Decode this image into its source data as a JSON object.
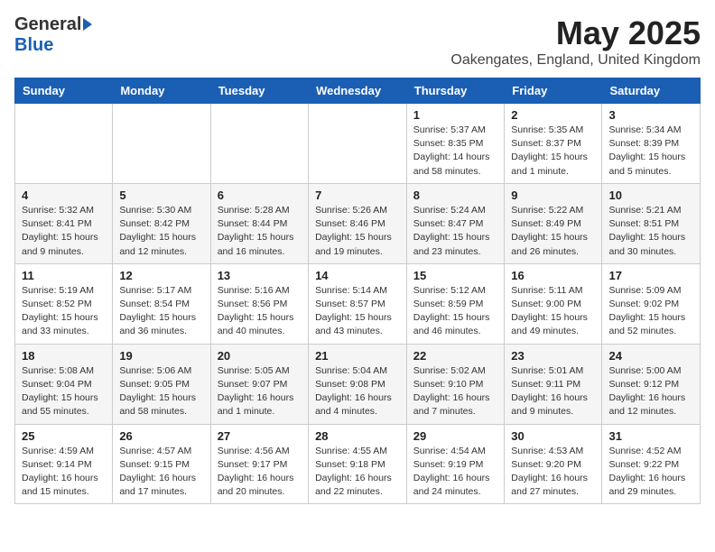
{
  "header": {
    "logo_general": "General",
    "logo_blue": "Blue",
    "month_title": "May 2025",
    "location": "Oakengates, England, United Kingdom"
  },
  "days_of_week": [
    "Sunday",
    "Monday",
    "Tuesday",
    "Wednesday",
    "Thursday",
    "Friday",
    "Saturday"
  ],
  "weeks": [
    [
      {
        "day": "",
        "info": ""
      },
      {
        "day": "",
        "info": ""
      },
      {
        "day": "",
        "info": ""
      },
      {
        "day": "",
        "info": ""
      },
      {
        "day": "1",
        "info": "Sunrise: 5:37 AM\nSunset: 8:35 PM\nDaylight: 14 hours\nand 58 minutes."
      },
      {
        "day": "2",
        "info": "Sunrise: 5:35 AM\nSunset: 8:37 PM\nDaylight: 15 hours\nand 1 minute."
      },
      {
        "day": "3",
        "info": "Sunrise: 5:34 AM\nSunset: 8:39 PM\nDaylight: 15 hours\nand 5 minutes."
      }
    ],
    [
      {
        "day": "4",
        "info": "Sunrise: 5:32 AM\nSunset: 8:41 PM\nDaylight: 15 hours\nand 9 minutes."
      },
      {
        "day": "5",
        "info": "Sunrise: 5:30 AM\nSunset: 8:42 PM\nDaylight: 15 hours\nand 12 minutes."
      },
      {
        "day": "6",
        "info": "Sunrise: 5:28 AM\nSunset: 8:44 PM\nDaylight: 15 hours\nand 16 minutes."
      },
      {
        "day": "7",
        "info": "Sunrise: 5:26 AM\nSunset: 8:46 PM\nDaylight: 15 hours\nand 19 minutes."
      },
      {
        "day": "8",
        "info": "Sunrise: 5:24 AM\nSunset: 8:47 PM\nDaylight: 15 hours\nand 23 minutes."
      },
      {
        "day": "9",
        "info": "Sunrise: 5:22 AM\nSunset: 8:49 PM\nDaylight: 15 hours\nand 26 minutes."
      },
      {
        "day": "10",
        "info": "Sunrise: 5:21 AM\nSunset: 8:51 PM\nDaylight: 15 hours\nand 30 minutes."
      }
    ],
    [
      {
        "day": "11",
        "info": "Sunrise: 5:19 AM\nSunset: 8:52 PM\nDaylight: 15 hours\nand 33 minutes."
      },
      {
        "day": "12",
        "info": "Sunrise: 5:17 AM\nSunset: 8:54 PM\nDaylight: 15 hours\nand 36 minutes."
      },
      {
        "day": "13",
        "info": "Sunrise: 5:16 AM\nSunset: 8:56 PM\nDaylight: 15 hours\nand 40 minutes."
      },
      {
        "day": "14",
        "info": "Sunrise: 5:14 AM\nSunset: 8:57 PM\nDaylight: 15 hours\nand 43 minutes."
      },
      {
        "day": "15",
        "info": "Sunrise: 5:12 AM\nSunset: 8:59 PM\nDaylight: 15 hours\nand 46 minutes."
      },
      {
        "day": "16",
        "info": "Sunrise: 5:11 AM\nSunset: 9:00 PM\nDaylight: 15 hours\nand 49 minutes."
      },
      {
        "day": "17",
        "info": "Sunrise: 5:09 AM\nSunset: 9:02 PM\nDaylight: 15 hours\nand 52 minutes."
      }
    ],
    [
      {
        "day": "18",
        "info": "Sunrise: 5:08 AM\nSunset: 9:04 PM\nDaylight: 15 hours\nand 55 minutes."
      },
      {
        "day": "19",
        "info": "Sunrise: 5:06 AM\nSunset: 9:05 PM\nDaylight: 15 hours\nand 58 minutes."
      },
      {
        "day": "20",
        "info": "Sunrise: 5:05 AM\nSunset: 9:07 PM\nDaylight: 16 hours\nand 1 minute."
      },
      {
        "day": "21",
        "info": "Sunrise: 5:04 AM\nSunset: 9:08 PM\nDaylight: 16 hours\nand 4 minutes."
      },
      {
        "day": "22",
        "info": "Sunrise: 5:02 AM\nSunset: 9:10 PM\nDaylight: 16 hours\nand 7 minutes."
      },
      {
        "day": "23",
        "info": "Sunrise: 5:01 AM\nSunset: 9:11 PM\nDaylight: 16 hours\nand 9 minutes."
      },
      {
        "day": "24",
        "info": "Sunrise: 5:00 AM\nSunset: 9:12 PM\nDaylight: 16 hours\nand 12 minutes."
      }
    ],
    [
      {
        "day": "25",
        "info": "Sunrise: 4:59 AM\nSunset: 9:14 PM\nDaylight: 16 hours\nand 15 minutes."
      },
      {
        "day": "26",
        "info": "Sunrise: 4:57 AM\nSunset: 9:15 PM\nDaylight: 16 hours\nand 17 minutes."
      },
      {
        "day": "27",
        "info": "Sunrise: 4:56 AM\nSunset: 9:17 PM\nDaylight: 16 hours\nand 20 minutes."
      },
      {
        "day": "28",
        "info": "Sunrise: 4:55 AM\nSunset: 9:18 PM\nDaylight: 16 hours\nand 22 minutes."
      },
      {
        "day": "29",
        "info": "Sunrise: 4:54 AM\nSunset: 9:19 PM\nDaylight: 16 hours\nand 24 minutes."
      },
      {
        "day": "30",
        "info": "Sunrise: 4:53 AM\nSunset: 9:20 PM\nDaylight: 16 hours\nand 27 minutes."
      },
      {
        "day": "31",
        "info": "Sunrise: 4:52 AM\nSunset: 9:22 PM\nDaylight: 16 hours\nand 29 minutes."
      }
    ]
  ]
}
